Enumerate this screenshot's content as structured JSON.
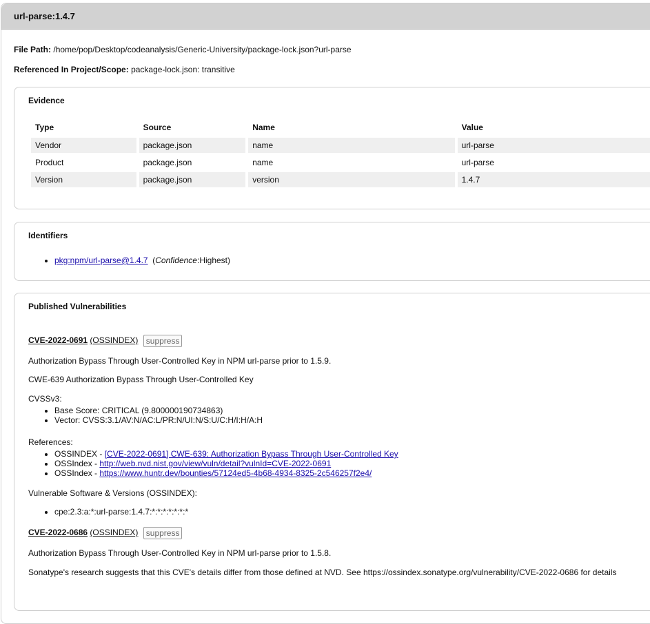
{
  "header": {
    "title": "url-parse:1.4.7"
  },
  "file_path": {
    "label": "File Path:",
    "value": "/home/pop/Desktop/codeanalysis/Generic-University/package-lock.json?url-parse"
  },
  "referenced": {
    "label": "Referenced In Project/Scope:",
    "value": "package-lock.json: transitive"
  },
  "evidence": {
    "title": "Evidence",
    "columns": [
      "Type",
      "Source",
      "Name",
      "Value"
    ],
    "rows": [
      [
        "Vendor",
        "package.json",
        "name",
        "url-parse"
      ],
      [
        "Product",
        "package.json",
        "name",
        "url-parse"
      ],
      [
        "Version",
        "package.json",
        "version",
        "1.4.7"
      ]
    ]
  },
  "identifiers": {
    "title": "Identifiers",
    "item_link": "pkg:npm/url-parse@1.4.7",
    "confidence_open": "(",
    "confidence_label": "Confidence",
    "confidence_value": ":Highest)"
  },
  "vulns": {
    "title": "Published Vulnerabilities",
    "cve1": {
      "id": "CVE-2022-0691",
      "source": "(OSSINDEX)",
      "suppress": "suppress",
      "description": "Authorization Bypass Through User-Controlled Key in NPM url-parse prior to 1.5.9.",
      "cwe": "CWE-639 Authorization Bypass Through User-Controlled Key",
      "cvss_title": "CVSSv3:",
      "base_score": "Base Score: CRITICAL (9.800000190734863)",
      "vector": "Vector: CVSS:3.1/AV:N/AC:L/PR:N/UI:N/S:U/C:H/I:H/A:H",
      "references_title": "References:",
      "refs": [
        {
          "prefix": "OSSINDEX - ",
          "link": "[CVE-2022-0691] CWE-639: Authorization Bypass Through User-Controlled Key"
        },
        {
          "prefix": "OSSIndex - ",
          "link": "http://web.nvd.nist.gov/view/vuln/detail?vulnId=CVE-2022-0691"
        },
        {
          "prefix": "OSSIndex - ",
          "link": "https://www.huntr.dev/bounties/57124ed5-4b68-4934-8325-2c546257f2e4/"
        }
      ],
      "vuln_sw_title": "Vulnerable Software & Versions (OSSINDEX):",
      "cpe": "cpe:2.3:a:*:url-parse:1.4.7:*:*:*:*:*:*:*"
    },
    "cve2": {
      "id": "CVE-2022-0686",
      "source": "(OSSINDEX)",
      "suppress": "suppress",
      "description": "Authorization Bypass Through User-Controlled Key in NPM url-parse prior to 1.5.8.",
      "note": "Sonatype's research suggests that this CVE's details differ from those defined at NVD. See https://ossindex.sonatype.org/vulnerability/CVE-2022-0686 for details"
    }
  }
}
